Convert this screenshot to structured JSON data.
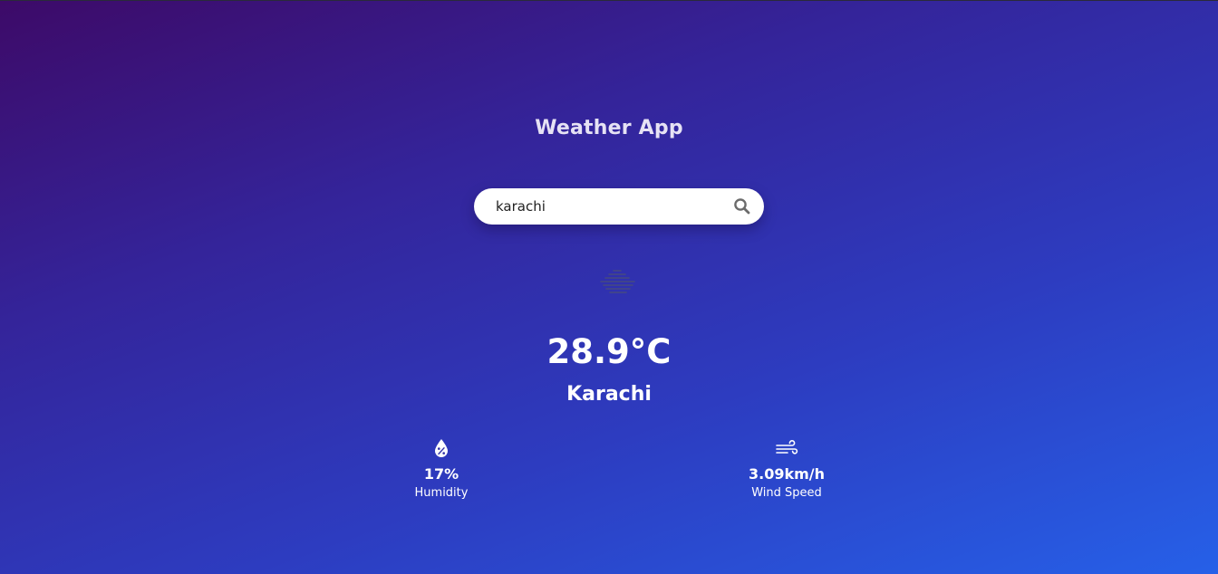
{
  "app": {
    "title": "Weather App"
  },
  "search": {
    "value": "karachi",
    "icon": "search-icon"
  },
  "weather": {
    "condition_icon": "mist-icon",
    "temperature": "28.9°C",
    "city": "Karachi"
  },
  "stats": {
    "humidity": {
      "icon": "humidity-icon",
      "value": "17%",
      "label": "Humidity"
    },
    "wind": {
      "icon": "wind-icon",
      "value": "3.09km/h",
      "label": "Wind Speed"
    }
  }
}
